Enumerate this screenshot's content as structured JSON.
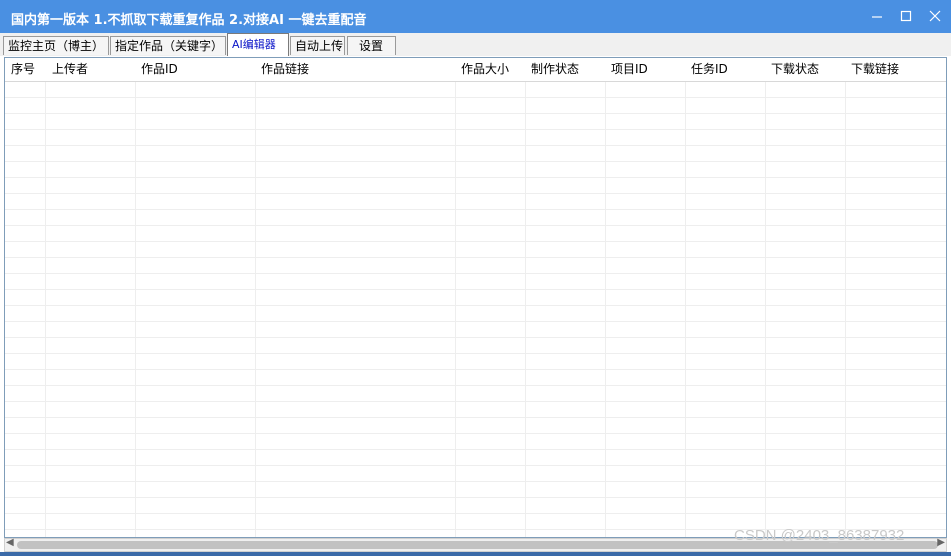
{
  "window": {
    "title": "国内第一版本 1.不抓取下载重复作品 2.对接AI 一键去重配音",
    "accent_color": "#4a90e2"
  },
  "tabs": [
    {
      "label": "监控主页（博主）",
      "active": false
    },
    {
      "label": "指定作品（关键字）",
      "active": false
    },
    {
      "label": "AI编辑器",
      "active": true
    },
    {
      "label": "自动上传",
      "active": false
    },
    {
      "label": "设置",
      "active": false
    }
  ],
  "table": {
    "columns": [
      "序号",
      "上传者",
      "作品ID",
      "作品链接",
      "作品大小",
      "制作状态",
      "项目ID",
      "任务ID",
      "下载状态",
      "下载链接"
    ],
    "rows": []
  },
  "watermark": "CSDN @2403_86387932",
  "icons": {
    "minimize": "minimize-icon",
    "maximize": "maximize-icon",
    "close": "close-icon"
  }
}
